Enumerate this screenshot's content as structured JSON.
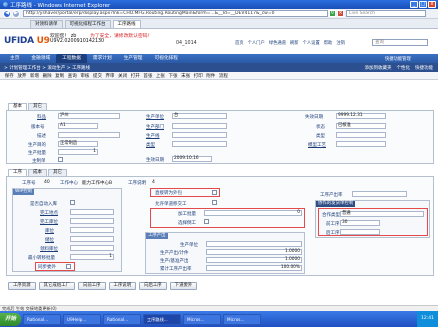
{
  "window": {
    "title": "工序路线 - Windows Internet Explorer",
    "min": "_",
    "max": "□",
    "close": "x"
  },
  "browser": {
    "address": "http://yshaver/portal/erp/display.aspx?lnk=CHO.MFG.Routing.RoutingMain&form=...&__Id=__DEV4117&_cw=0",
    "search_placeholder": "Live Search",
    "tabs": [
      "对领料请单",
      "可视化排程工作台",
      "工序路线"
    ],
    "active_tab": 2
  },
  "header": {
    "logo_main": "UFIDA",
    "logo_u9": "U9",
    "welcome": "欢迎您！ zb",
    "warning": "为了安全，请修改默认密码！",
    "org_label": "U9V2.0200910142130",
    "date": "04_1014",
    "links": [
      "首页",
      "个人门户",
      "绿色通道",
      "刷新",
      "个人设置",
      "帮助",
      "注销"
    ],
    "search_placeholder": "查询"
  },
  "appnav": {
    "items": [
      "主页",
      "金融领域",
      "工程数据",
      "需求计划",
      "生产管理",
      "可视化排程"
    ],
    "active": 2
  },
  "crumbs": {
    "path": "> 计划管理工作台 > 滚动生产 > 工序路线",
    "right_links": [
      "添加到收藏夹",
      "个性化",
      "快捷功能",
      "快捷功能管理"
    ]
  },
  "actions": [
    "保存",
    "放弃",
    "新增",
    "删除",
    "复制",
    "查询",
    "审核",
    "提交",
    "弃审",
    "关闭",
    "打开",
    "首张",
    "上张",
    "下张",
    "末张",
    "打印",
    "附件",
    "流程"
  ],
  "main_tabs": [
    "基本",
    "其它"
  ],
  "basic": {
    "item_label": "料品",
    "item_value": "泸州",
    "version_label": "版本号",
    "version_value": "A1",
    "desc_label": "描述",
    "category_label": "生产目的",
    "category_value": "正常制造",
    "base_label": "生产批量",
    "base_value": "1",
    "main_label": "主制单",
    "prod_unit_label": "生产单位",
    "prod_unit_value": "台",
    "prod_dept_label": "生产部门",
    "route_type_label": "生产线",
    "eff_date_label": "生效日期",
    "eff_date_value": "2009.10.16",
    "fail_date_label": "失效日期",
    "fail_date_value": "9999.12.31",
    "status_label": "状态",
    "status_value": "已核准",
    "class_label": "类型",
    "mode_label": "类型",
    "template_label": "模型工艺"
  },
  "sub_tabs": [
    "工序",
    "成本",
    "其它"
  ],
  "op": {
    "op_no_label": "工序号",
    "op_no_value": "40",
    "wc_label": "工作中心",
    "wc_value": "能力工作中心B",
    "desc_label": "工序说明",
    "desc_value": "4",
    "wip_title": "WIP控制",
    "wip_fields": [
      "是否自动入库",
      "完工地点",
      "完工库位",
      "库位",
      "储位",
      "领料库位",
      "最小转移批量",
      "同步委外"
    ],
    "min_batch_value": "1",
    "sub_flags": [
      "直接转为外包",
      "允许单道移交工",
      "加工批量",
      "选择倒工"
    ],
    "batch_value": "0",
    "factor_title": "工序产出",
    "factor_fields": [
      "生产单位",
      "生产产出/计件",
      "生产/基准产出",
      "累计工序产出率"
    ],
    "factor_rate_value": "1.0000",
    "factor_base_value": "1.0000",
    "factor_cum_value": "100.00%",
    "out_rate_label": "工序产出率",
    "out_rate_value": "",
    "coop_title": "协作的发货单控制",
    "coop_fields": [
      "合作类型",
      "前工序",
      "后工序"
    ],
    "coop_type_value": "普通",
    "coop_prev_value": "30"
  },
  "bottom_buttons": [
    "工序资源",
    "其它成组工厂",
    "向前工序",
    "工序说明",
    "向后工序",
    "下道委外"
  ],
  "statusbar": "完成后 生效 交接地委更新(0)",
  "taskbar": {
    "start": "开始",
    "tasks": [
      "Rational...",
      "U9Help...",
      "Rational...",
      "工序路线...",
      "Micros...",
      "Micros..."
    ],
    "active": 3,
    "clock": "12:41"
  }
}
